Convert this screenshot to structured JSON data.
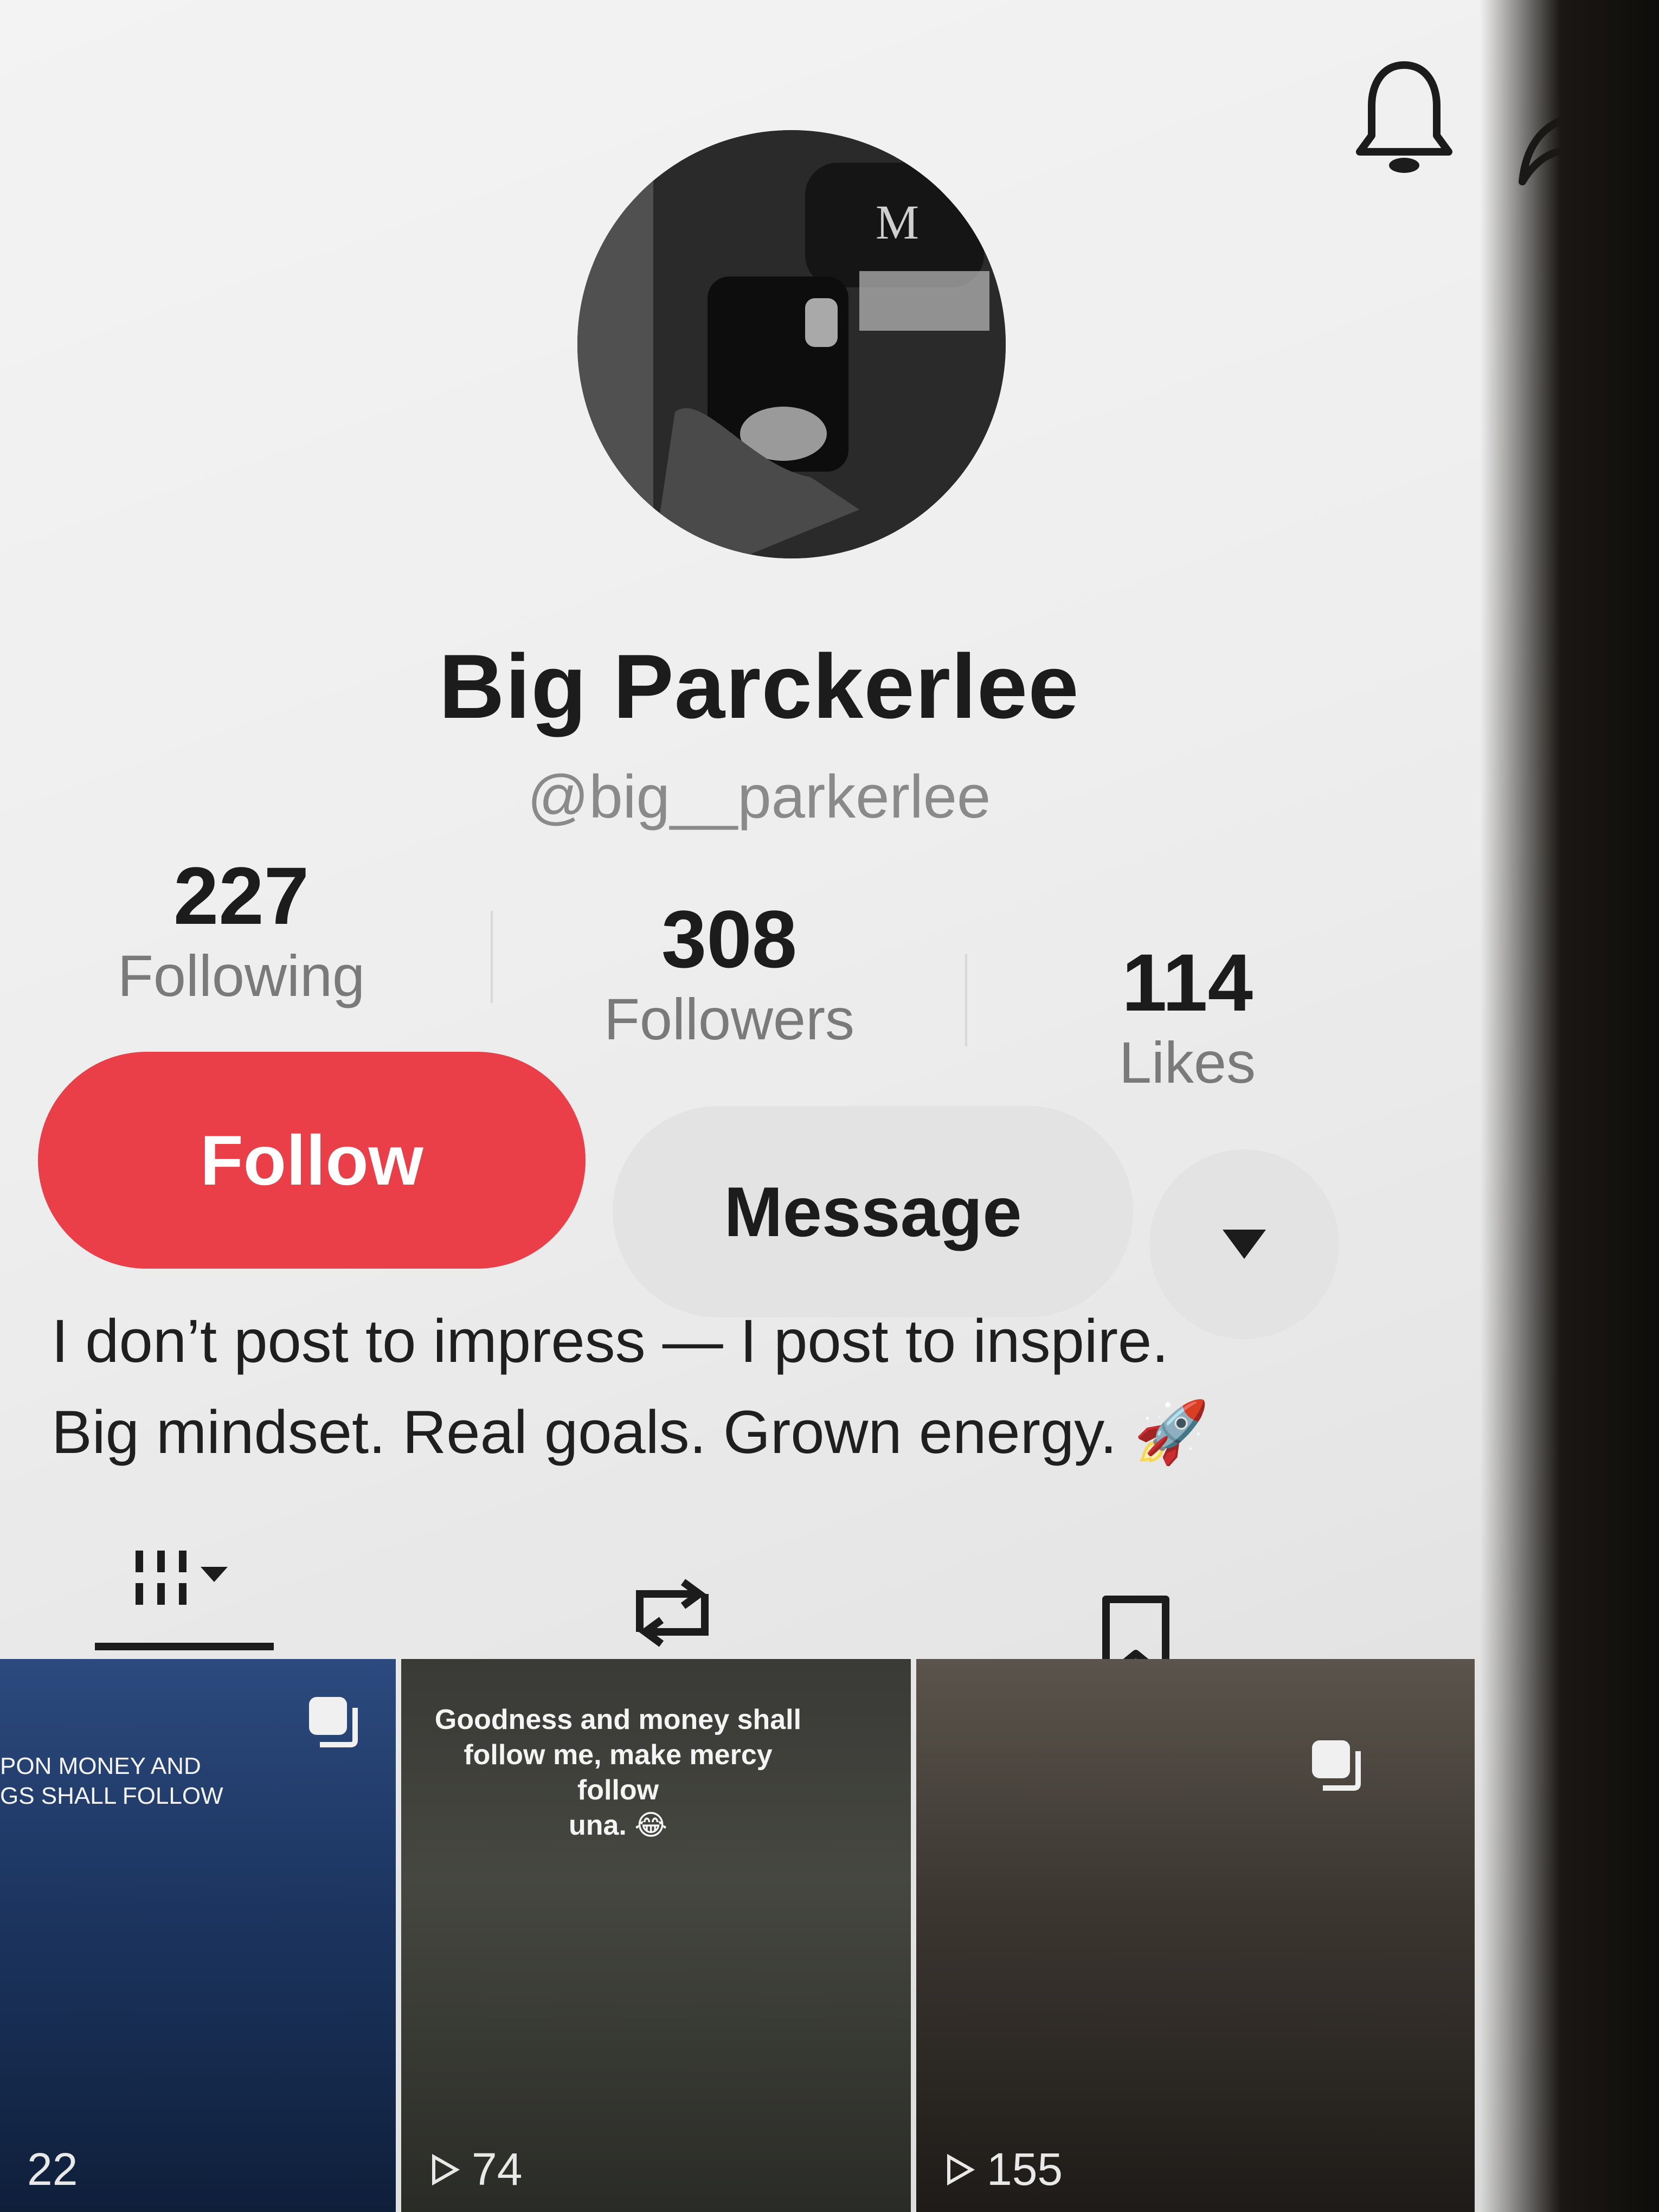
{
  "header": {
    "bell_icon": "bell-icon",
    "share_icon": "share-arrow-icon"
  },
  "profile": {
    "display_name": "Big Parckerlee",
    "handle": "@big__parkerlee"
  },
  "stats": {
    "following": {
      "value": "227",
      "label": "Following"
    },
    "followers": {
      "value": "308",
      "label": "Followers"
    },
    "likes": {
      "value": "114",
      "label": "Likes"
    }
  },
  "actions": {
    "follow_label": "Follow",
    "message_label": "Message",
    "more_icon": "caret-down-icon",
    "follow_color": "#ea3e48"
  },
  "bio": {
    "line1": "I don’t post to impress — I post to inspire.",
    "line2": "Big mindset. Real goals. Grown energy. 🚀"
  },
  "tabs": [
    {
      "name": "videos",
      "icon": "grid-icon",
      "active": true
    },
    {
      "name": "reposts",
      "icon": "repost-icon",
      "active": false
    },
    {
      "name": "saved",
      "icon": "bookmark-icon",
      "active": false
    }
  ],
  "videos": [
    {
      "caption": "PON MONEY AND\nGS SHALL FOLLOW",
      "views": "22"
    },
    {
      "caption": "Goodness and money shall\nfollow me, make mercy follow\nuna. 😂",
      "views": "74"
    },
    {
      "caption": "",
      "views": "155"
    }
  ]
}
